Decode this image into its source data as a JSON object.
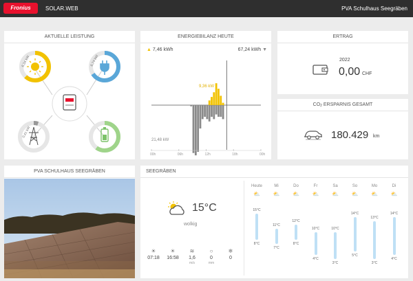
{
  "header": {
    "logo": "Fronius",
    "app": "SOLAR.WEB",
    "site": "PVA Schulhaus Seegräben"
  },
  "leistung": {
    "title": "AKTUELLE LEISTUNG",
    "pv": "6,34 kW",
    "load": "6,74 kW",
    "grid": "0,41 kW",
    "colors": {
      "pv": "#f2c200",
      "load": "#5aa7d8",
      "grid": "#999999",
      "battery": "#9fd48a"
    },
    "pv_fraction": 0.62,
    "load_fraction": 0.66,
    "grid_fraction": 0.05,
    "battery_fraction": 0.6
  },
  "bilanz": {
    "title": "ENERGIEBILANZ HEUTE",
    "produced": "7,46 kWh",
    "consumed": "67,24 kWh",
    "peak_label": "9,36 kW",
    "low_label": "21,48 kW",
    "chart_data": {
      "type": "bar",
      "x_ticks": [
        "00h",
        "06h",
        "12h",
        "18h",
        "00h"
      ],
      "xlim": [
        0,
        24
      ],
      "x": [
        8.5,
        9,
        9.5,
        10,
        10.5,
        11,
        11.5,
        12,
        12.5,
        13,
        13.5,
        14,
        14.5,
        15,
        15.5
      ],
      "series": [
        {
          "values": [
            -0.5,
            -20.5,
            -21.5,
            -20,
            -10,
            -6,
            -5,
            -6,
            -7,
            -5,
            -6,
            -4,
            -5,
            -5,
            -6
          ]
        },
        {
          "values": [
            0,
            0,
            0,
            0,
            0,
            0,
            0,
            0,
            2,
            3.5,
            5.5,
            9.36,
            7,
            4,
            1
          ]
        }
      ]
    }
  },
  "ertrag": {
    "title": "ERTRAG",
    "year": "2022",
    "value": "0,00",
    "unit": "CHF"
  },
  "co2": {
    "title_prefix": "CO",
    "title_sub": "2",
    "title_suffix": " ERSPARNIS GESAMT",
    "value": "180.429",
    "unit": "km"
  },
  "photo": {
    "title": "PVA SCHULHAUS SEEGRÄBEN"
  },
  "weather": {
    "title": "SEEGRÄBEN",
    "temp": "15°C",
    "condition": "wolkig",
    "icon": "partly-cloudy-icon",
    "stats": [
      {
        "icon": "sunrise-icon",
        "value": "07:18",
        "unit": ""
      },
      {
        "icon": "sunset-icon",
        "value": "16:58",
        "unit": ""
      },
      {
        "icon": "wind-icon",
        "value": "1,6",
        "unit": "m/s"
      },
      {
        "icon": "rain-icon",
        "value": "0",
        "unit": "mm"
      },
      {
        "icon": "snow-icon",
        "value": "0",
        "unit": ""
      }
    ],
    "days": [
      {
        "label": "Heute",
        "high": "15°C",
        "low": "8°C",
        "hi": 15,
        "lo": 8
      },
      {
        "label": "Mi",
        "high": "11°C",
        "low": "7°C",
        "hi": 11,
        "lo": 7
      },
      {
        "label": "Do",
        "high": "12°C",
        "low": "8°C",
        "hi": 12,
        "lo": 8
      },
      {
        "label": "Fr",
        "high": "10°C",
        "low": "4°C",
        "hi": 10,
        "lo": 4
      },
      {
        "label": "Sa",
        "high": "10°C",
        "low": "3°C",
        "hi": 10,
        "lo": 3
      },
      {
        "label": "So",
        "high": "14°C",
        "low": "5°C",
        "hi": 14,
        "lo": 5
      },
      {
        "label": "Mo",
        "high": "13°C",
        "low": "3°C",
        "hi": 13,
        "lo": 3
      },
      {
        "label": "Di",
        "high": "14°C",
        "low": "4°C",
        "hi": 14,
        "lo": 4
      }
    ]
  }
}
